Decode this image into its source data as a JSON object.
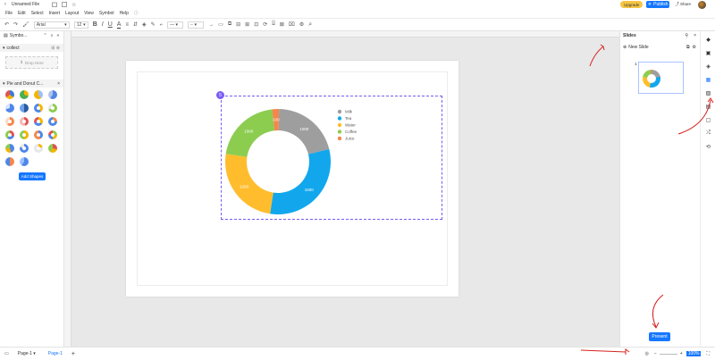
{
  "app": {
    "file_name": "Unnamed File",
    "upgrade_label": "Upgrade",
    "publish_label": "Publish",
    "share_label": "Share"
  },
  "menu": [
    "File",
    "Edit",
    "Select",
    "Insert",
    "Layout",
    "View",
    "Symbol",
    "Help"
  ],
  "toolbar": {
    "font_family": "Arial",
    "font_size": "12"
  },
  "left_panel": {
    "title": "Symbo...",
    "search_section": "collect",
    "drop_hint": "Drop Here",
    "library_section": "Pie and Donut C...",
    "add_shapes_label": "Add Shapes"
  },
  "chart_data": {
    "type": "pie",
    "donut": true,
    "categories": [
      "Milk",
      "Tea",
      "Water",
      "Coffee",
      "Juice"
    ],
    "values": [
      1000,
      1500,
      1200,
      1000,
      100
    ],
    "data_labels": [
      "1000",
      "1500",
      "1200",
      "1000",
      "100"
    ],
    "colors": [
      "#9e9e9e",
      "#12a7ec",
      "#ffbd2e",
      "#8ccd50",
      "#f4874b"
    ],
    "legend_position": "right"
  },
  "selection_badge": "5",
  "right_panel": {
    "title": "Slides",
    "new_slide_label": "New Slide",
    "slide_number": "1",
    "present_label": "Present"
  },
  "status": {
    "page_selector": "Page-1",
    "page_tab": "Page-1",
    "zoom": "100%"
  }
}
